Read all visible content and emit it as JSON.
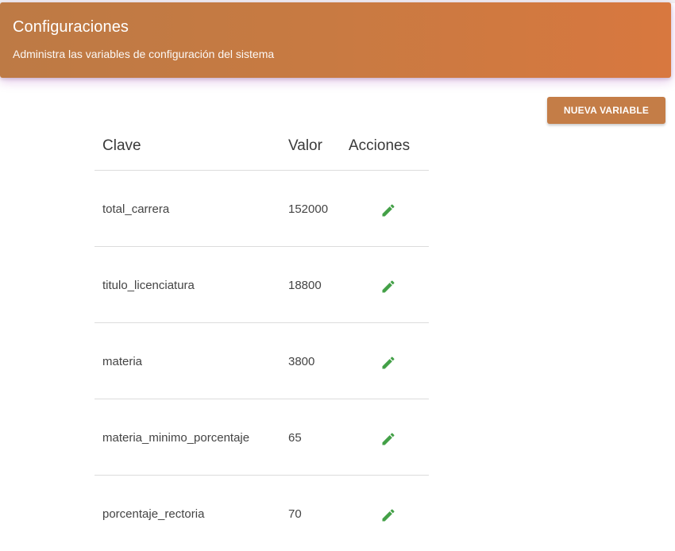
{
  "header": {
    "title": "Configuraciones",
    "subtitle": "Administra las variables de configuración del sistema"
  },
  "actions": {
    "add_label": "NUEVA VARIABLE"
  },
  "table": {
    "columns": {
      "key": "Clave",
      "value": "Valor",
      "actions": "Acciones"
    },
    "rows": [
      {
        "key": "total_carrera",
        "value": "152000",
        "action_icon": "edit-icon"
      },
      {
        "key": "titulo_licenciatura",
        "value": "18800",
        "action_icon": "edit-icon"
      },
      {
        "key": "materia",
        "value": "3800",
        "action_icon": "edit-icon"
      },
      {
        "key": "materia_minimo_porcentaje",
        "value": "65",
        "action_icon": "edit-icon"
      },
      {
        "key": "porcentaje_rectoria",
        "value": "70",
        "action_icon": "edit-icon"
      }
    ]
  },
  "colors": {
    "header_gradient_start": "#bd7a45",
    "header_gradient_end": "#d8783f",
    "button": "#c47d47",
    "edit_icon": "#43a047"
  }
}
